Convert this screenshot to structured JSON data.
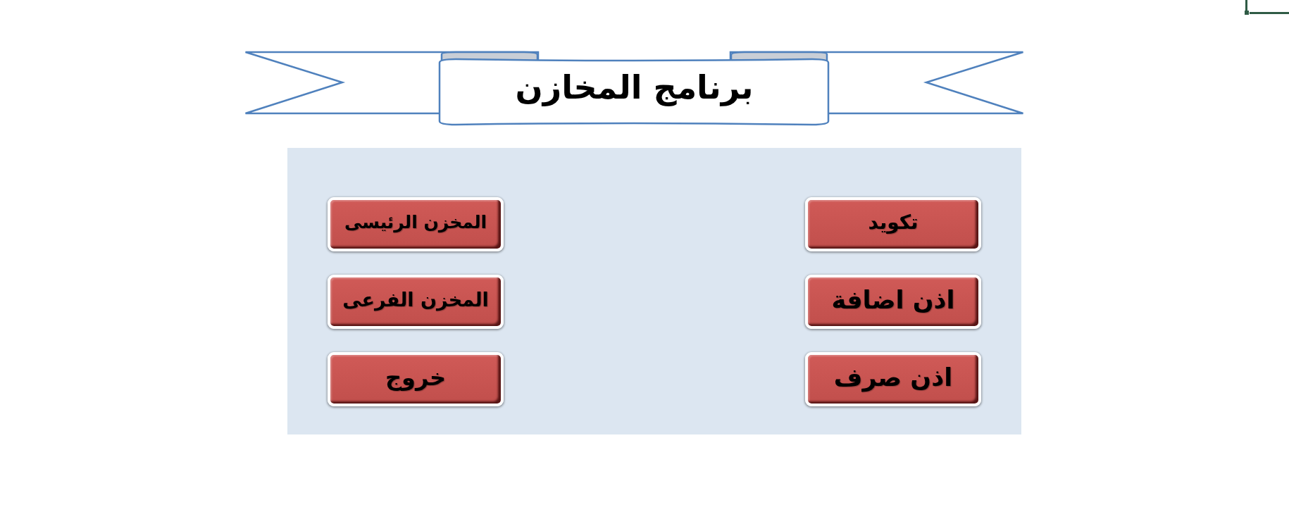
{
  "banner": {
    "title": "برنامج المخازن"
  },
  "panel": {
    "columns": [
      {
        "buttons": [
          "تكويد",
          "اذن اضافة",
          "اذن صرف"
        ]
      },
      {
        "buttons": [
          "المخزن الرئيسى",
          "المخزن الفرعى",
          "خروج"
        ]
      }
    ]
  }
}
